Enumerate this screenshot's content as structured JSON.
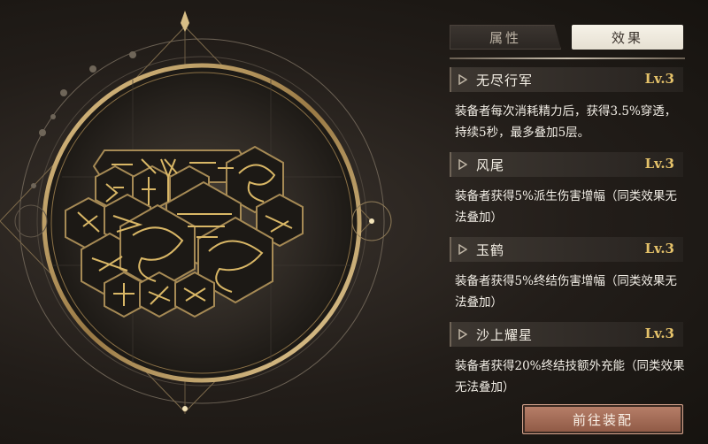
{
  "tabs": [
    {
      "label": "属性",
      "active": false
    },
    {
      "label": "效果",
      "active": true
    }
  ],
  "effects": [
    {
      "name": "无尽行军",
      "level": "Lv.3",
      "desc": "装备者每次消耗精力后，获得3.5%穿透，持续5秒，最多叠加5层。"
    },
    {
      "name": "风尾",
      "level": "Lv.3",
      "desc": "装备者获得5%派生伤害增幅（同类效果无法叠加）"
    },
    {
      "name": "玉鹤",
      "level": "Lv.3",
      "desc": "装备者获得5%终结伤害增幅（同类效果无法叠加）"
    },
    {
      "name": "沙上耀星",
      "level": "Lv.3",
      "desc": "装备者获得20%终结技额外充能（同类效果无法叠加）"
    }
  ],
  "equip_button_label": "前往装配",
  "colors": {
    "accent_gold": "#c9a55c",
    "level_gold": "#e6c36a",
    "button": "#a06a55",
    "active_tab": "#f2eee6"
  },
  "icons": {
    "effect_arrow": "arrow-right-icon",
    "emblem": "emblem-hexagon-cluster-icon"
  }
}
